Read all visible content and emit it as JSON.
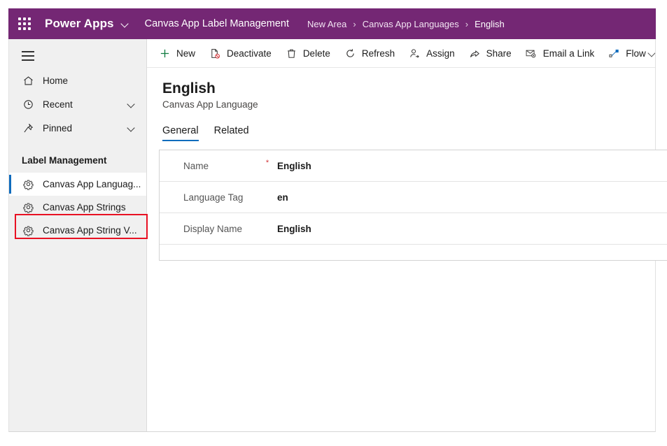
{
  "app_bar": {
    "waffle_icon": "app-launcher-waffle-icon",
    "brand": "Power Apps",
    "brand_chevron_icon": "chevron-down-icon",
    "environment": "Canvas App Label Management",
    "breadcrumb": [
      {
        "label": "New Area",
        "current": false
      },
      {
        "label": "Canvas App Languages",
        "current": false
      },
      {
        "label": "English",
        "current": true
      }
    ],
    "breadcrumb_separator": "›",
    "purple": "#742774"
  },
  "sidebar": {
    "hamburger_icon": "hamburger-menu-icon",
    "nav": [
      {
        "label": "Home",
        "icon": "home-icon",
        "chevron": false
      },
      {
        "label": "Recent",
        "icon": "clock-icon",
        "chevron": true
      },
      {
        "label": "Pinned",
        "icon": "pin-icon",
        "chevron": true
      }
    ],
    "group_header": "Label Management",
    "group_items": [
      {
        "label": "Canvas App Languag...",
        "icon": "gear-icon",
        "selected": true
      },
      {
        "label": "Canvas App Strings",
        "icon": "gear-icon",
        "selected": false
      },
      {
        "label": "Canvas App String V...",
        "icon": "gear-icon",
        "selected": false
      }
    ],
    "selected_accent": "#0f6cbd",
    "highlight_color": "#e81123"
  },
  "command_bar": {
    "items": [
      {
        "label": "New",
        "icon": "plus-icon",
        "chevron": false
      },
      {
        "label": "Deactivate",
        "icon": "deactivate-icon",
        "chevron": false
      },
      {
        "label": "Delete",
        "icon": "trash-icon",
        "chevron": false
      },
      {
        "label": "Refresh",
        "icon": "refresh-icon",
        "chevron": false
      },
      {
        "label": "Assign",
        "icon": "assign-person-icon",
        "chevron": false
      },
      {
        "label": "Share",
        "icon": "share-icon",
        "chevron": false
      },
      {
        "label": "Email a Link",
        "icon": "email-link-icon",
        "chevron": false
      },
      {
        "label": "Flow",
        "icon": "flow-icon",
        "chevron": true
      },
      {
        "label": "",
        "icon": "word-template-icon",
        "chevron": false
      }
    ]
  },
  "record": {
    "title": "English",
    "subtitle": "Canvas App Language"
  },
  "tabs": [
    {
      "label": "General",
      "active": true
    },
    {
      "label": "Related",
      "active": false
    }
  ],
  "form": {
    "rows": [
      {
        "label": "Name",
        "required": "*",
        "value": "English"
      },
      {
        "label": "Language Tag",
        "required": "",
        "value": "en"
      },
      {
        "label": "Display Name",
        "required": "",
        "value": "English"
      }
    ]
  }
}
